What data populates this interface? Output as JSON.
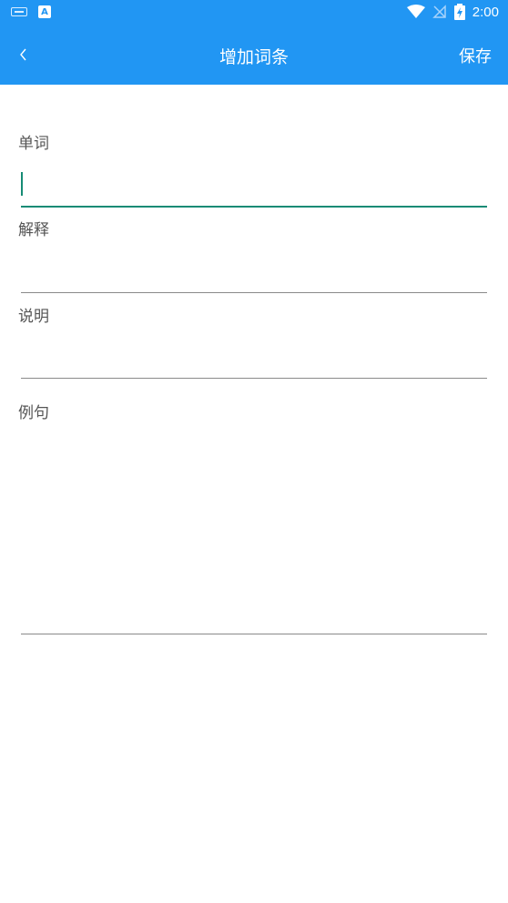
{
  "status_bar": {
    "time": "2:00",
    "icons": [
      "keyboard-icon",
      "a-badge-icon",
      "wifi-icon",
      "no-signal-icon",
      "battery-charging-icon"
    ]
  },
  "app_bar": {
    "back_glyph": "<",
    "title": "增加词条",
    "save_label": "保存"
  },
  "form": {
    "fields": [
      {
        "label": "单词",
        "value": ""
      },
      {
        "label": "解释",
        "value": ""
      },
      {
        "label": "说明",
        "value": ""
      },
      {
        "label": "例句",
        "value": ""
      }
    ]
  },
  "colors": {
    "primary": "#2196f3",
    "accent": "#168b75"
  }
}
